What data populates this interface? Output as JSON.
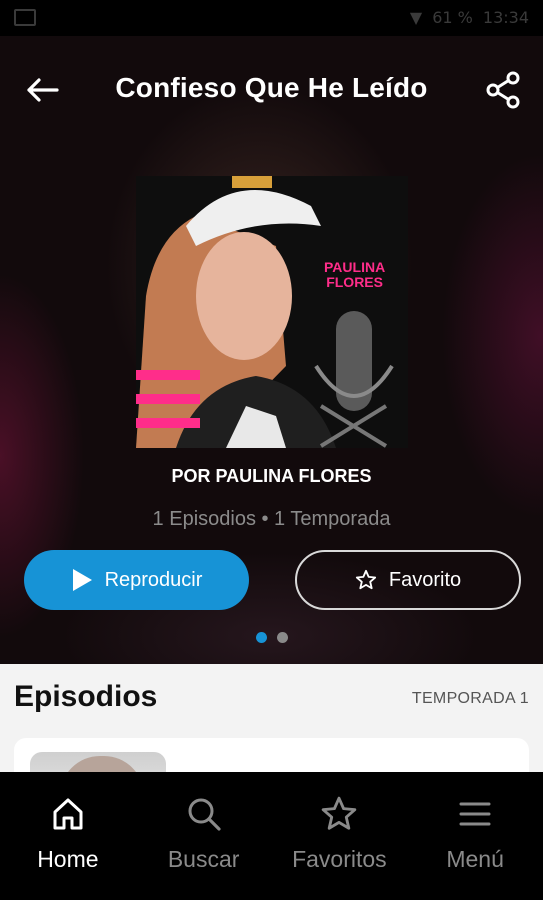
{
  "status_bar": {
    "battery": "61 %",
    "time": "13:34"
  },
  "header": {
    "title": "Confieso Que He Leído"
  },
  "cover": {
    "artist_line1": "PAULINA",
    "artist_line2": "FLORES"
  },
  "show": {
    "author": "POR PAULINA FLORES",
    "meta": "1 Episodios • 1 Temporada"
  },
  "actions": {
    "play_label": "Reproducir",
    "favorite_label": "Favorito"
  },
  "pager": {
    "count": 2,
    "active": 0
  },
  "episodes": {
    "title": "Episodios",
    "season": "TEMPORADA 1"
  },
  "nav": [
    {
      "label": "Home",
      "icon": "home-icon",
      "active": true
    },
    {
      "label": "Buscar",
      "icon": "search-icon",
      "active": false
    },
    {
      "label": "Favoritos",
      "icon": "star-icon",
      "active": false
    },
    {
      "label": "Menú",
      "icon": "menu-icon",
      "active": false
    }
  ],
  "colors": {
    "accent": "#1793d6",
    "brand_pink": "#ff2d8a",
    "nav_active": "#ffffff",
    "nav_inactive": "#8a8a8a",
    "dot_active": "#1793d6",
    "dot_inactive": "#8a8a8a"
  }
}
